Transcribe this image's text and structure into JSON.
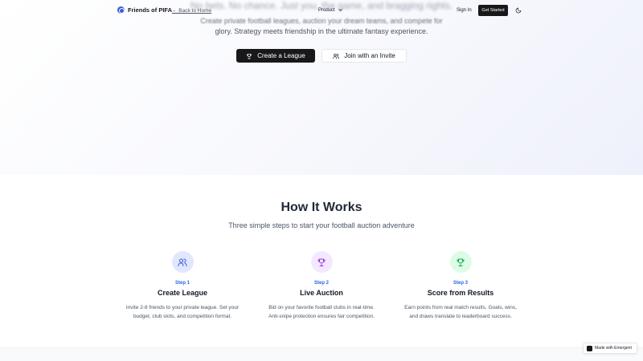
{
  "nav": {
    "brand": "Friends of PIFA",
    "back_link": "← Back to Home",
    "product": "Product",
    "sign_in": "Sign In",
    "get_started": "Get Started"
  },
  "hero": {
    "tagline": "No bets. No chance. Just you, the game, and bragging rights.",
    "desc_line1": "Create private football leagues, auction your dream teams, and compete for",
    "desc_line2": "glory. Strategy meets friendship in the ultimate fantasy experience.",
    "create_label": "Create a League",
    "join_label": "Join with an Invite"
  },
  "how": {
    "title": "How It Works",
    "subtitle": "Three simple steps to start your football auction adventure",
    "steps": [
      {
        "num": "Step 1",
        "name": "Create League",
        "desc1": "Invite 2-8 friends to your private league. Set your",
        "desc2": "budget, club slots, and competition format.",
        "icon": "users-icon",
        "bg": "#e0e7ff",
        "color": "#3b5bdb"
      },
      {
        "num": "Step 2",
        "name": "Live Auction",
        "desc1": "Bid on your favorite football clubs in real-time.",
        "desc2": "Anti-snipe protection ensures fair competition.",
        "icon": "trophy-icon",
        "bg": "#f3e8ff",
        "color": "#9333ea"
      },
      {
        "num": "Step 3",
        "name": "Score from Results",
        "desc1": "Earn points from real match results. Goals, wins,",
        "desc2": "and draws translate to leaderboard success.",
        "icon": "trophy-icon",
        "bg": "#dcfce7",
        "color": "#16a34a"
      }
    ]
  },
  "badge": {
    "label": "Made with Emergent"
  }
}
